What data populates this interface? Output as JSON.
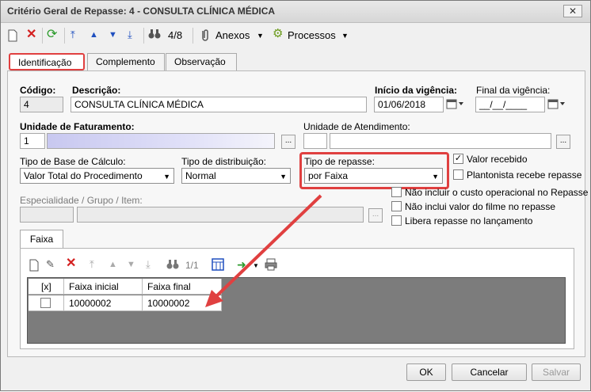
{
  "window": {
    "title": "Critério Geral de Repasse: 4 - CONSULTA CLÍNICA MÉDICA",
    "close": "✕"
  },
  "toolbar": {
    "record_count": "4/8",
    "attachments_label": "Anexos",
    "processes_label": "Processos"
  },
  "tabs": [
    "Identificação",
    "Complemento",
    "Observação"
  ],
  "fields": {
    "codigo_label": "Código:",
    "codigo_value": "4",
    "descricao_label": "Descrição:",
    "descricao_value": "CONSULTA CLÍNICA MÉDICA",
    "inicio_label": "Início da vigência:",
    "inicio_value": "01/06/2018",
    "final_label": "Final da vigência:",
    "final_value": "__/__/____",
    "unidade_fat_label": "Unidade de Faturamento:",
    "unidade_fat_value": "1",
    "unidade_atend_label": "Unidade de Atendimento:",
    "base_calc_label": "Tipo de Base de Cálculo:",
    "base_calc_value": "Valor Total do Procedimento",
    "distribuicao_label": "Tipo de distribuição:",
    "distribuicao_value": "Normal",
    "tipo_repasse_label": "Tipo de repasse:",
    "tipo_repasse_value": "por Faixa",
    "especialidade_label": "Especialidade / Grupo / Item:"
  },
  "checkboxes": [
    {
      "label": "Valor recebido",
      "checked": true
    },
    {
      "label": "Plantonista recebe repasse",
      "checked": false
    },
    {
      "label": "Não incluir o custo operacional no Repasse",
      "checked": false
    },
    {
      "label": "Não inclui valor do filme no repasse",
      "checked": false
    },
    {
      "label": "Libera repasse no lançamento",
      "checked": false
    }
  ],
  "faixa": {
    "tab_label": "Faixa",
    "record_count": "1/1",
    "columns": [
      "[x]",
      "Faixa inicial",
      "Faixa final"
    ],
    "rows": [
      {
        "checked": false,
        "inicial": "10000002",
        "final": "10000002"
      }
    ]
  },
  "buttons": {
    "ok": "OK",
    "cancel": "Cancelar",
    "save": "Salvar"
  },
  "colors": {
    "highlight": "#e04040"
  }
}
